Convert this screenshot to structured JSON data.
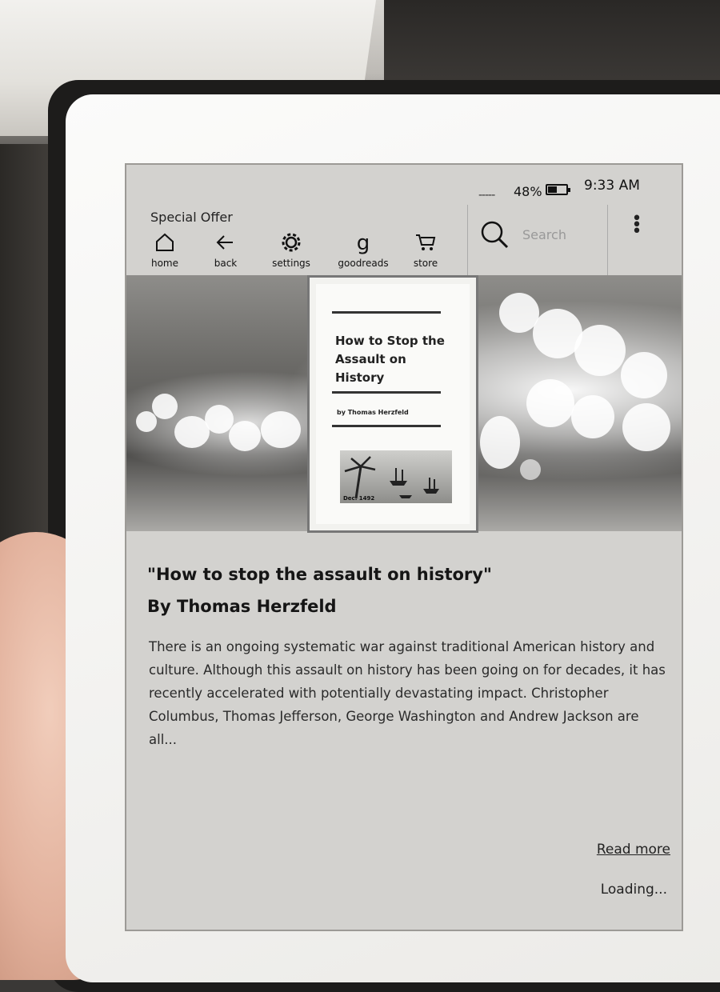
{
  "status_bar": {
    "signal": "-----",
    "battery_percent": "48%",
    "battery_level": 0.48,
    "time": "9:33 AM"
  },
  "banner": {
    "label": "Special Offer"
  },
  "toolbar": {
    "items": [
      {
        "label": "home",
        "icon": "home-icon"
      },
      {
        "label": "back",
        "icon": "back-arrow-icon"
      },
      {
        "label": "settings",
        "icon": "gear-icon"
      },
      {
        "label": "goodreads",
        "icon": "goodreads-icon"
      },
      {
        "label": "store",
        "icon": "cart-icon"
      }
    ],
    "search_placeholder": "Search"
  },
  "cover": {
    "title": "How to Stop the Assault on History",
    "author": "by Thomas Herzfeld",
    "caption": "Dec. 1492"
  },
  "book": {
    "title": "\"How to stop the assault on history\"",
    "byline": "By Thomas Herzfeld",
    "description": "There is an ongoing systematic war against traditional American history and culture. Although this assault on history has been going on for decades, it has recently accelerated with potentially devastating impact. Christopher Columbus, Thomas Jefferson, George Washington and Andrew Jackson are all..."
  },
  "actions": {
    "read_more": "Read more",
    "loading": "Loading..."
  }
}
